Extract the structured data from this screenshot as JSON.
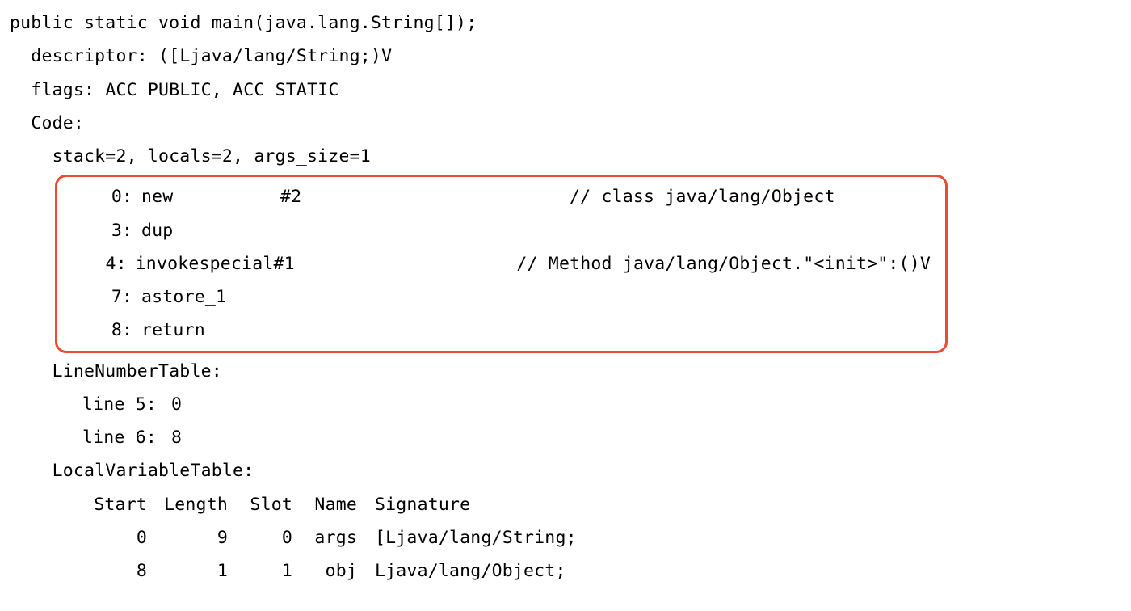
{
  "signature": "public static void main(java.lang.String[]);",
  "descriptor_label": "descriptor:",
  "descriptor_value": "([Ljava/lang/String;)V",
  "flags_label": "flags:",
  "flags_value": "ACC_PUBLIC, ACC_STATIC",
  "code_label": "Code:",
  "stack_line": "stack=2, locals=2, args_size=1",
  "instructions": [
    {
      "offset": "0",
      "opcode": "new",
      "arg": "#2",
      "comment": "// class java/lang/Object"
    },
    {
      "offset": "3",
      "opcode": "dup",
      "arg": "",
      "comment": ""
    },
    {
      "offset": "4",
      "opcode": "invokespecial",
      "arg": "#1",
      "comment": "// Method java/lang/Object.\"<init>\":()V"
    },
    {
      "offset": "7",
      "opcode": "astore_1",
      "arg": "",
      "comment": ""
    },
    {
      "offset": "8",
      "opcode": "return",
      "arg": "",
      "comment": ""
    }
  ],
  "lnt_label": "LineNumberTable:",
  "lnt": [
    {
      "label": "line 5:",
      "value": "0"
    },
    {
      "label": "line 6:",
      "value": "8"
    }
  ],
  "lvt_label": "LocalVariableTable:",
  "lvt_headers": {
    "start": "Start",
    "length": "Length",
    "slot": "Slot",
    "name": "Name",
    "sig": "Signature"
  },
  "lvt_rows": [
    {
      "start": "0",
      "length": "9",
      "slot": "0",
      "name": "args",
      "sig": "[Ljava/lang/String;"
    },
    {
      "start": "8",
      "length": "1",
      "slot": "1",
      "name": "obj",
      "sig": "Ljava/lang/Object;"
    }
  ]
}
